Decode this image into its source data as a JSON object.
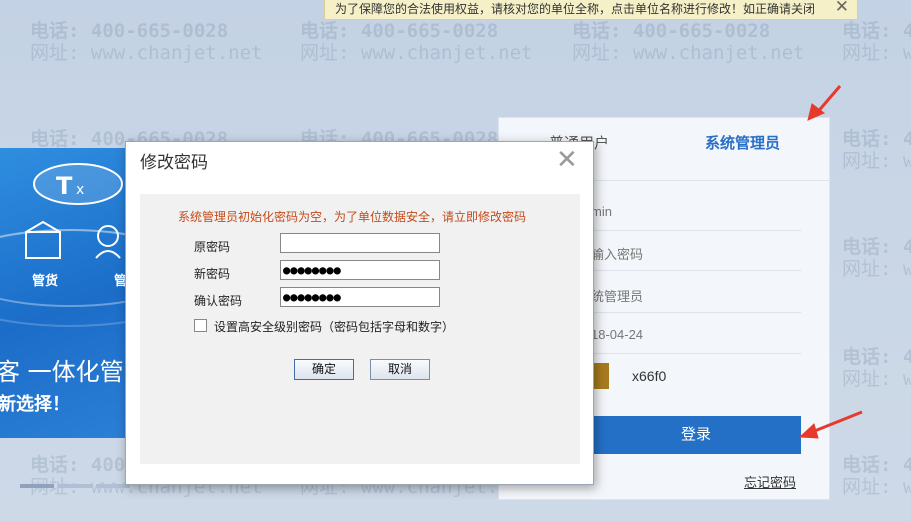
{
  "notice": {
    "text": "为了保障您的合法使用权益，请核对您的单位全称，点击单位名称进行修改！如正确请关闭",
    "close": "✕"
  },
  "watermark": {
    "phone": "电话: 400-665-0028",
    "site": "网址: www.chanjet.net"
  },
  "banner": {
    "headline": "客 一体化管",
    "subline": "新选择！",
    "icon_label_1": "管货",
    "icon_label_2": "管"
  },
  "login": {
    "tabs": [
      "普通用户",
      "系统管理员"
    ],
    "username": "min",
    "password_placeholder": "输入密码",
    "role": "统管理员",
    "date": "18-04-24",
    "captcha": "x66f0",
    "login_button": "登录",
    "forgot_link": "忘记密码"
  },
  "dialog": {
    "title": "修改密码",
    "close": "✕",
    "warning": "系统管理员初始化密码为空，为了单位数据安全，请立即修改密码",
    "fields": [
      {
        "label": "原密码",
        "value": ""
      },
      {
        "label": "新密码",
        "value": "●●●●●●●●"
      },
      {
        "label": "确认密码",
        "value": "●●●●●●●●"
      }
    ],
    "checkbox_label": "设置高安全级别密码（密码包括字母和数字）",
    "ok_button": "确定",
    "cancel_button": "取消"
  },
  "colors": {
    "accent": "#2470c6",
    "annotation_arrow": "#e73a2a",
    "warning_text": "#c44b1b"
  }
}
